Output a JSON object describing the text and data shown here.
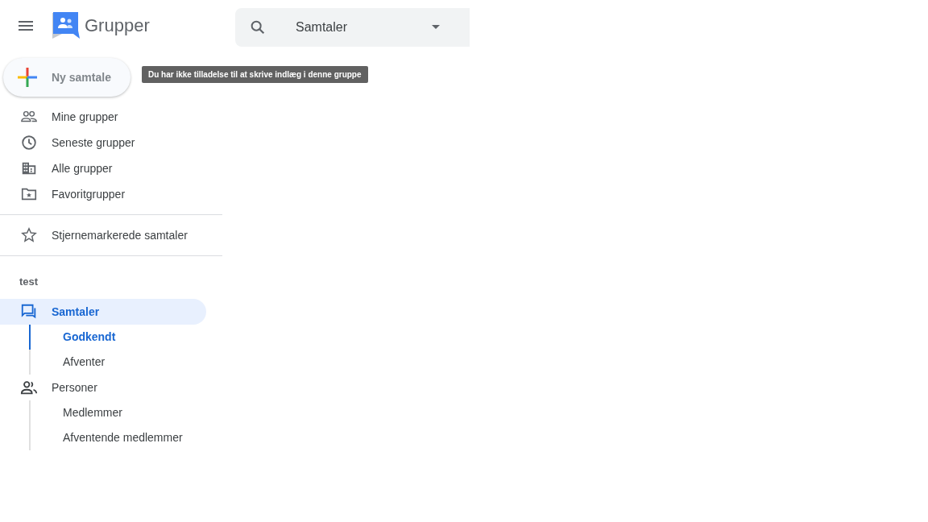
{
  "app": {
    "title": "Grupper"
  },
  "search": {
    "scope": "Samtaler"
  },
  "new_button": {
    "label": "Ny samtale",
    "disabled": true
  },
  "tooltip": "Du har ikke tilladelse til at skrive indlæg i denne gruppe",
  "nav": [
    {
      "kind": "people",
      "label": "Mine grupper"
    },
    {
      "kind": "clock",
      "label": "Seneste grupper"
    },
    {
      "kind": "building",
      "label": "Alle grupper"
    },
    {
      "kind": "folder",
      "label": "Favoritgrupper"
    }
  ],
  "starred": {
    "label": "Stjernemarkerede samtaler"
  },
  "group": {
    "name": "test",
    "sections": [
      {
        "kind": "chat",
        "label": "Samtaler",
        "selected": true,
        "children": [
          {
            "label": "Godkendt",
            "selected": true
          },
          {
            "label": "Afventer",
            "selected": false
          }
        ]
      },
      {
        "kind": "person",
        "label": "Personer",
        "selected": false,
        "children": [
          {
            "label": "Medlemmer",
            "selected": false
          },
          {
            "label": "Afventende medlemmer",
            "selected": false
          }
        ]
      }
    ]
  }
}
